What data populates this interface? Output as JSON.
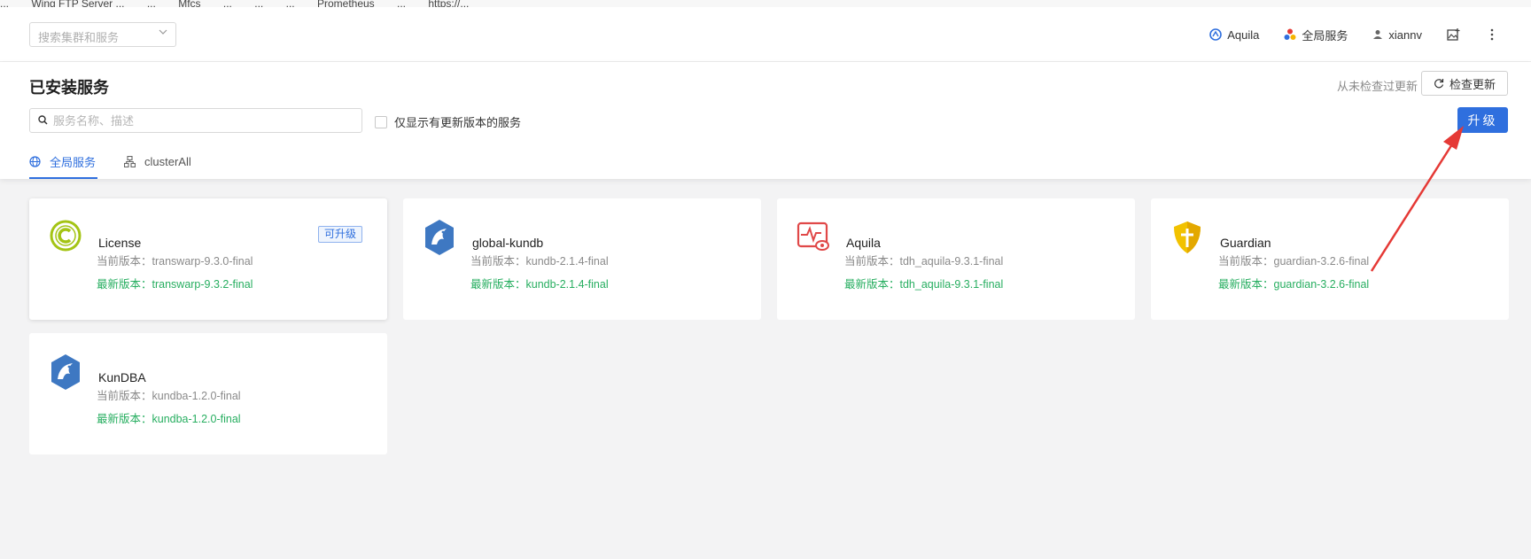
{
  "bookmarks": [
    "...",
    "Wing FTP Server ...",
    "...",
    "Mfcs",
    "...",
    "...",
    "...",
    "Prometheus",
    "...",
    "https://..."
  ],
  "topbar": {
    "cluster_placeholder": "搜索集群和服务",
    "items": [
      {
        "label": "Aquila",
        "icon": "aquila-icon"
      },
      {
        "label": "全局服务",
        "icon": "global-services-icon"
      },
      {
        "label": "xiannv",
        "icon": "user-icon"
      }
    ]
  },
  "header": {
    "title": "已安装服务",
    "last_check": "从未检查过更新",
    "check_update_label": "检查更新",
    "search_placeholder": "服务名称、描述",
    "only_update_label": "仅显示有更新版本的服务",
    "upgrade_label": "升级",
    "tabs": [
      {
        "label": "全局服务",
        "icon": "globe-icon",
        "active": true
      },
      {
        "label": "clusterAll",
        "icon": "cluster-icon",
        "active": false
      }
    ]
  },
  "services": [
    {
      "name": "License",
      "current": "当前版本：transwarp-9.3.0-final",
      "latest": "最新版本：transwarp-9.3.2-final",
      "badge": "可升级",
      "icon": "license-icon"
    },
    {
      "name": "global-kundb",
      "current": "当前版本：kundb-2.1.4-final",
      "latest": "最新版本：kundb-2.1.4-final",
      "badge": "",
      "icon": "kundb-icon"
    },
    {
      "name": "Aquila",
      "current": "当前版本：tdh_aquila-9.3.1-final",
      "latest": "最新版本：tdh_aquila-9.3.1-final",
      "badge": "",
      "icon": "aquila-monitor-icon"
    },
    {
      "name": "Guardian",
      "current": "当前版本：guardian-3.2.6-final",
      "latest": "最新版本：guardian-3.2.6-final",
      "badge": "",
      "icon": "guardian-shield-icon"
    },
    {
      "name": "KunDBA",
      "current": "当前版本：kundba-1.2.0-final",
      "latest": "最新版本：kundba-1.2.0-final",
      "badge": "",
      "icon": "kundba-icon"
    }
  ],
  "colors": {
    "primary": "#2f6fde",
    "latest_green": "#27ae60",
    "annotation_red": "#e53935"
  }
}
